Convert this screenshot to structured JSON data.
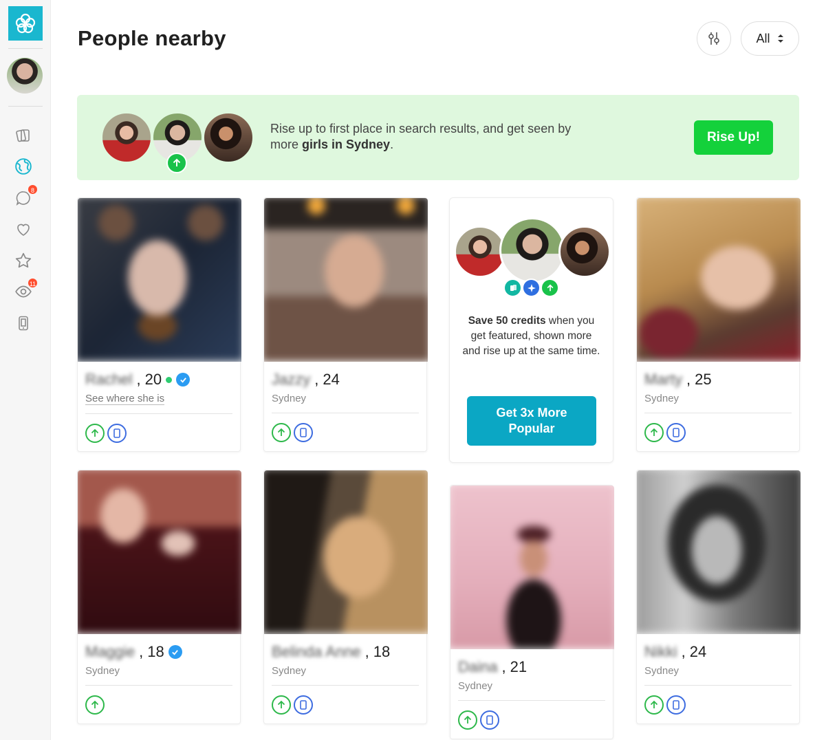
{
  "page": {
    "title": "People nearby"
  },
  "header": {
    "filter_label": "All"
  },
  "sidebar": {
    "message_badge": "8",
    "visitors_badge": "11"
  },
  "promo": {
    "text_pre": "Rise up to first place in search results, and get seen by more ",
    "text_bold": "girls in Sydney",
    "text_post": ".",
    "button": "Rise Up!"
  },
  "upsell": {
    "text_bold": "Save 50 credits",
    "text_rest": " when you get featured, shown more and rise up at the same time.",
    "button": "Get 3x More Popular"
  },
  "profiles": [
    {
      "name": "Rachel",
      "age": "20",
      "city": "See where she is"
    },
    {
      "name": "Jazzy",
      "age": "24",
      "city": "Sydney"
    },
    {
      "name": "Marty",
      "age": "25",
      "city": "Sydney"
    },
    {
      "name": "Maggie",
      "age": "18",
      "city": "Sydney"
    },
    {
      "name": "Belinda Anne",
      "age": "18",
      "city": "Sydney"
    },
    {
      "name": "Daina",
      "age": "21",
      "city": "Sydney"
    },
    {
      "name": "Nikki",
      "age": "24",
      "city": "Sydney"
    }
  ],
  "colors": {
    "accent": "#1ab7cf",
    "rise_green": "#14d13b",
    "promo_bg": "#dff8de",
    "verified_blue": "#2b9cf2",
    "badge_red": "#ff4d2e"
  }
}
